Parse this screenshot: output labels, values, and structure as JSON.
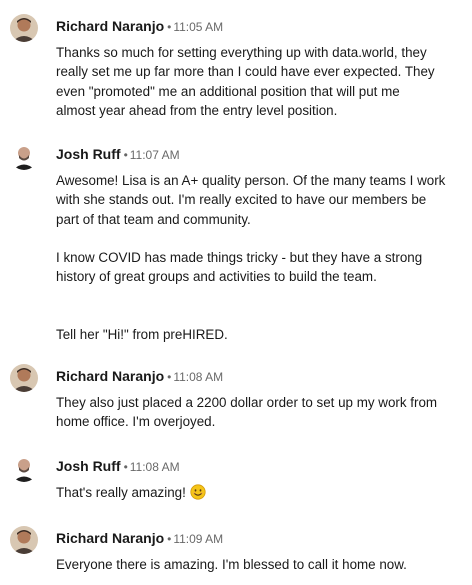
{
  "messages": [
    {
      "sender": "Richard Naranjo",
      "separator": "•",
      "time": "11:05 AM",
      "lines": [
        "Thanks so much for setting everything up with data.world, they",
        "really set me up far more than I could have ever expected. They",
        "even \"promoted\" me an additional position that will put me",
        "almost year ahead from the entry level position."
      ]
    },
    {
      "sender": "Josh Ruff",
      "separator": "•",
      "time": "11:07 AM",
      "lines": [
        "Awesome! Lisa is an A+ quality person. Of the many teams I work",
        "with she stands out. I'm really excited to have our members be",
        "part of that team and community.",
        "",
        "I know COVID has made things tricky - but they have a strong",
        "history of great groups and activities to build the team.",
        "",
        "",
        "Tell her \"Hi!\" from preHIRED."
      ]
    },
    {
      "sender": "Richard Naranjo",
      "separator": "•",
      "time": "11:08 AM",
      "lines": [
        "They also just placed a 2200 dollar order to set up my work from",
        "home office. I'm overjoyed."
      ]
    },
    {
      "sender": "Josh Ruff",
      "separator": "•",
      "time": "11:08 AM",
      "lines": [
        "That's really amazing!"
      ],
      "emoji_icon": "smiling-face-emoji"
    },
    {
      "sender": "Richard Naranjo",
      "separator": "•",
      "time": "11:09 AM",
      "lines": [
        "Everyone there is amazing. I'm blessed to call it home now."
      ]
    }
  ],
  "colors": {
    "text": "#191919",
    "meta": "#666666",
    "emoji": "#f5c518"
  }
}
